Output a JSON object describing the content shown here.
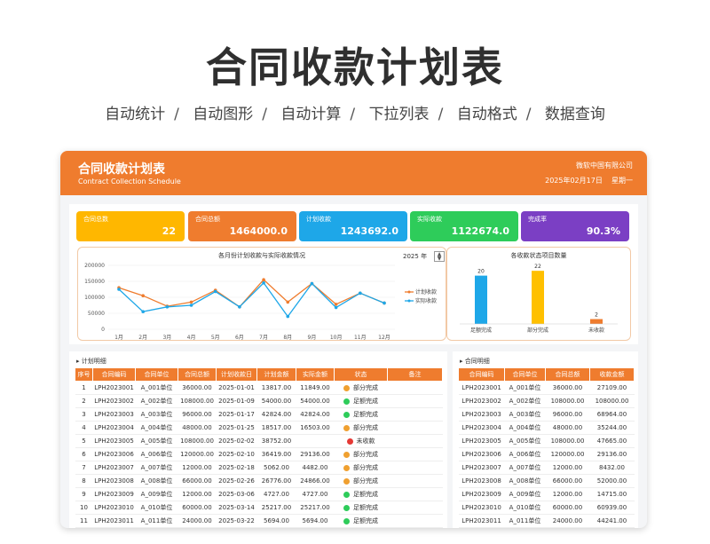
{
  "hero": {
    "title": "合同收款计划表",
    "features": [
      "自动统计",
      "自动图形",
      "自动计算",
      "下拉列表",
      "自动格式",
      "数据查询"
    ]
  },
  "header": {
    "title": "合同收款计划表",
    "subtitle": "Contract Collection Schedule",
    "company": "微软中国有限公司",
    "date": "2025年02月17日",
    "weekday": "星期一"
  },
  "kpis": [
    {
      "label": "合同总数",
      "value": "22",
      "color": "#ffb700"
    },
    {
      "label": "合同总额",
      "value": "1464000.0",
      "color": "#ef7c2e"
    },
    {
      "label": "计划收款",
      "value": "1243692.0",
      "color": "#1ea7e8"
    },
    {
      "label": "实际收款",
      "value": "1122674.0",
      "color": "#2ecc5a"
    },
    {
      "label": "完成率",
      "value": "90.3%",
      "color": "#7b3fc4"
    }
  ],
  "line_chart": {
    "title": "各月份计划收款与实际收款情况",
    "year": "2025",
    "year_unit": "年",
    "chart_data": {
      "type": "line",
      "categories": [
        "1月",
        "2月",
        "3月",
        "4月",
        "5月",
        "6月",
        "7月",
        "8月",
        "9月",
        "10月",
        "11月",
        "12月"
      ],
      "series": [
        {
          "name": "计划收款",
          "color": "#ef7c2e",
          "values": [
            130000,
            105000,
            72000,
            85000,
            122000,
            70000,
            155000,
            85000,
            143000,
            78000,
            113000,
            82000
          ]
        },
        {
          "name": "实际收款",
          "color": "#1ea7e8",
          "values": [
            125000,
            55000,
            70000,
            75000,
            118000,
            70000,
            145000,
            40000,
            143000,
            68000,
            113000,
            82000
          ]
        }
      ],
      "yticks": [
        "200000",
        "150000",
        "100000",
        "50000",
        "0"
      ],
      "ylim": [
        0,
        200000
      ],
      "legend": "right"
    }
  },
  "bar_chart": {
    "title": "各收款状态项目数量",
    "chart_data": {
      "type": "bar",
      "categories": [
        "足额完成",
        "部分完成",
        "未收款"
      ],
      "values": [
        20,
        22,
        2
      ],
      "colors": [
        "#1ea7e8",
        "#ffc000",
        "#ef7c2e"
      ],
      "ylim": [
        0,
        25
      ]
    }
  },
  "left_table": {
    "title": "计划明细",
    "headers": [
      "序号",
      "合同编码",
      "合同单位",
      "合同总额",
      "计划收款日",
      "计划金额",
      "实际金额",
      "状态",
      "备注"
    ],
    "rows": [
      {
        "no": "1",
        "code": "LPH2023001",
        "unit": "A_001单位",
        "total": "36000.00",
        "date": "2025-01-01",
        "plan": "13817.00",
        "actual": "11849.00",
        "status": "部分完成",
        "status_color": "#f0a030",
        "note": ""
      },
      {
        "no": "2",
        "code": "LPH2023002",
        "unit": "A_002单位",
        "total": "108000.00",
        "date": "2025-01-09",
        "plan": "54000.00",
        "actual": "54000.00",
        "status": "足额完成",
        "status_color": "#2ecc5a",
        "note": ""
      },
      {
        "no": "3",
        "code": "LPH2023003",
        "unit": "A_003单位",
        "total": "96000.00",
        "date": "2025-01-17",
        "plan": "42824.00",
        "actual": "42824.00",
        "status": "足额完成",
        "status_color": "#2ecc5a",
        "note": ""
      },
      {
        "no": "4",
        "code": "LPH2023004",
        "unit": "A_004单位",
        "total": "48000.00",
        "date": "2025-01-25",
        "plan": "18517.00",
        "actual": "16503.00",
        "status": "部分完成",
        "status_color": "#f0a030",
        "note": ""
      },
      {
        "no": "5",
        "code": "LPH2023005",
        "unit": "A_005单位",
        "total": "108000.00",
        "date": "2025-02-02",
        "plan": "38752.00",
        "actual": "",
        "status": "未收款",
        "status_color": "#e53935",
        "note": ""
      },
      {
        "no": "6",
        "code": "LPH2023006",
        "unit": "A_006单位",
        "total": "120000.00",
        "date": "2025-02-10",
        "plan": "36419.00",
        "actual": "29136.00",
        "status": "部分完成",
        "status_color": "#f0a030",
        "note": ""
      },
      {
        "no": "7",
        "code": "LPH2023007",
        "unit": "A_007单位",
        "total": "12000.00",
        "date": "2025-02-18",
        "plan": "5062.00",
        "actual": "4482.00",
        "status": "部分完成",
        "status_color": "#f0a030",
        "note": ""
      },
      {
        "no": "8",
        "code": "LPH2023008",
        "unit": "A_008单位",
        "total": "66000.00",
        "date": "2025-02-26",
        "plan": "26776.00",
        "actual": "24866.00",
        "status": "部分完成",
        "status_color": "#f0a030",
        "note": ""
      },
      {
        "no": "9",
        "code": "LPH2023009",
        "unit": "A_009单位",
        "total": "12000.00",
        "date": "2025-03-06",
        "plan": "4727.00",
        "actual": "4727.00",
        "status": "足额完成",
        "status_color": "#2ecc5a",
        "note": ""
      },
      {
        "no": "10",
        "code": "LPH2023010",
        "unit": "A_010单位",
        "total": "60000.00",
        "date": "2025-03-14",
        "plan": "25217.00",
        "actual": "25217.00",
        "status": "足额完成",
        "status_color": "#2ecc5a",
        "note": ""
      },
      {
        "no": "11",
        "code": "LPH2023011",
        "unit": "A_011单位",
        "total": "24000.00",
        "date": "2025-03-22",
        "plan": "5694.00",
        "actual": "5694.00",
        "status": "足额完成",
        "status_color": "#2ecc5a",
        "note": ""
      }
    ]
  },
  "right_table": {
    "title": "合同明细",
    "headers": [
      "合同编码",
      "合同单位",
      "合同总额",
      "收款金额"
    ],
    "rows": [
      {
        "code": "LPH2023001",
        "unit": "A_001单位",
        "total": "36000.00",
        "received": "27109.00"
      },
      {
        "code": "LPH2023002",
        "unit": "A_002单位",
        "total": "108000.00",
        "received": "108000.00"
      },
      {
        "code": "LPH2023003",
        "unit": "A_003单位",
        "total": "96000.00",
        "received": "68964.00"
      },
      {
        "code": "LPH2023004",
        "unit": "A_004单位",
        "total": "48000.00",
        "received": "35244.00"
      },
      {
        "code": "LPH2023005",
        "unit": "A_005单位",
        "total": "108000.00",
        "received": "47665.00"
      },
      {
        "code": "LPH2023006",
        "unit": "A_006单位",
        "total": "120000.00",
        "received": "29136.00"
      },
      {
        "code": "LPH2023007",
        "unit": "A_007单位",
        "total": "12000.00",
        "received": "8432.00"
      },
      {
        "code": "LPH2023008",
        "unit": "A_008单位",
        "total": "66000.00",
        "received": "52000.00"
      },
      {
        "code": "LPH2023009",
        "unit": "A_009单位",
        "total": "12000.00",
        "received": "14715.00"
      },
      {
        "code": "LPH2023010",
        "unit": "A_010单位",
        "total": "60000.00",
        "received": "60939.00"
      },
      {
        "code": "LPH2023011",
        "unit": "A_011单位",
        "total": "24000.00",
        "received": "44241.00"
      }
    ]
  }
}
